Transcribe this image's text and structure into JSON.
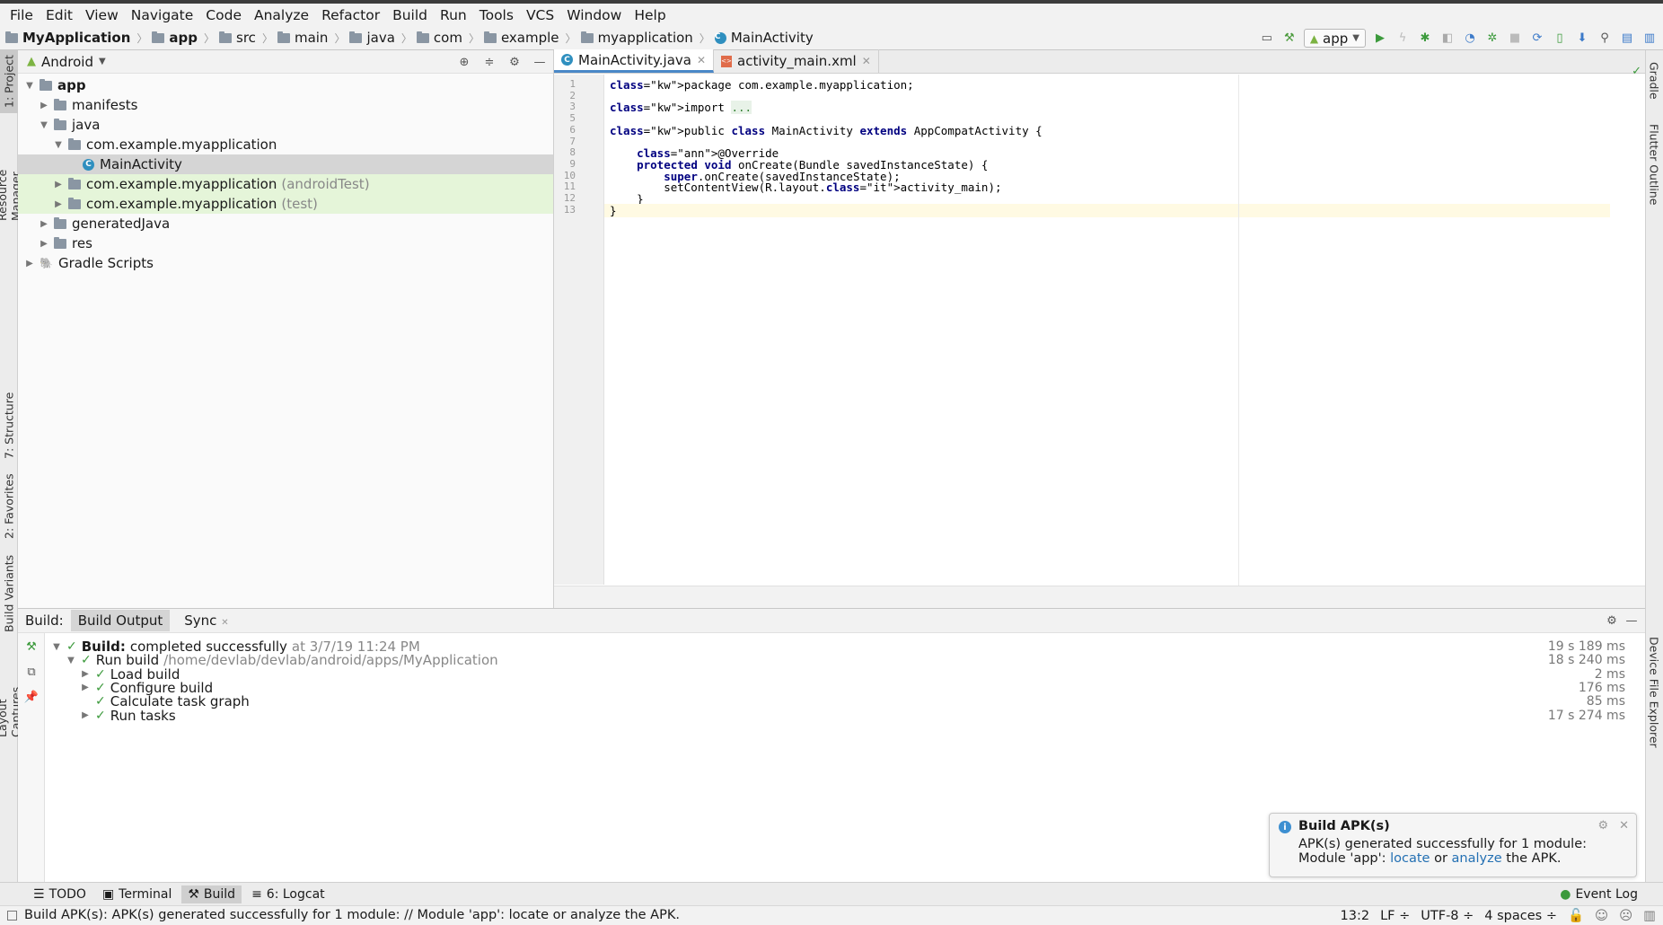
{
  "menu": [
    "File",
    "Edit",
    "View",
    "Navigate",
    "Code",
    "Analyze",
    "Refactor",
    "Build",
    "Run",
    "Tools",
    "VCS",
    "Window",
    "Help"
  ],
  "breadcrumb": [
    "MyApplication",
    "app",
    "src",
    "main",
    "java",
    "com",
    "example",
    "myapplication",
    "MainActivity"
  ],
  "run_config": "app",
  "project": {
    "view": "Android",
    "tree": [
      {
        "label": "app",
        "suffix": "",
        "depth": 0,
        "expanded": true,
        "bold": true
      },
      {
        "label": "manifests",
        "suffix": "",
        "depth": 1,
        "expanded": false
      },
      {
        "label": "java",
        "suffix": "",
        "depth": 1,
        "expanded": true
      },
      {
        "label": "com.example.myapplication",
        "suffix": "",
        "depth": 2,
        "expanded": true
      },
      {
        "label": "MainActivity",
        "suffix": "",
        "depth": 3,
        "leaf": true,
        "selected": true
      },
      {
        "label": "com.example.myapplication",
        "suffix": "(androidTest)",
        "depth": 2,
        "expanded": false,
        "test": true
      },
      {
        "label": "com.example.myapplication",
        "suffix": "(test)",
        "depth": 2,
        "expanded": false,
        "test": true
      },
      {
        "label": "generatedJava",
        "suffix": "",
        "depth": 1,
        "expanded": false
      },
      {
        "label": "res",
        "suffix": "",
        "depth": 1,
        "expanded": false
      },
      {
        "label": "Gradle Scripts",
        "suffix": "",
        "depth": 0,
        "expanded": false
      }
    ]
  },
  "left_tabs": [
    "1: Project",
    "Resource Manager",
    "7: Structure",
    "2: Favorites",
    "Build Variants",
    "Layout Captures"
  ],
  "right_tabs": [
    "Gradle",
    "Flutter Outline",
    "Device File Explorer"
  ],
  "editor": {
    "tabs": [
      {
        "label": "MainActivity.java",
        "active": true
      },
      {
        "label": "activity_main.xml",
        "active": false
      }
    ],
    "line_numbers": [
      "1",
      "2",
      "3",
      "5",
      "6",
      "7",
      "8",
      "9",
      "10",
      "11",
      "12",
      "13"
    ],
    "lines": [
      "package com.example.myapplication;",
      "",
      "import ...",
      "",
      "public class MainActivity extends AppCompatActivity {",
      "",
      "    @Override",
      "    protected void onCreate(Bundle savedInstanceState) {",
      "        super.onCreate(savedInstanceState);",
      "        setContentView(R.layout.activity_main);",
      "    }",
      "}"
    ]
  },
  "build": {
    "label": "Build:",
    "tabs": [
      "Build Output",
      "Sync"
    ],
    "rows": [
      {
        "bold": "Build:",
        "text": "completed successfully",
        "dim": "at 3/7/19 11:24 PM",
        "time": "19 s 189 ms"
      },
      {
        "bold": "",
        "text": "Run build",
        "dim": "/home/devlab/devlab/android/apps/MyApplication",
        "time": "18 s 240 ms"
      },
      {
        "bold": "",
        "text": "Load build",
        "dim": "",
        "time": "2 ms"
      },
      {
        "bold": "",
        "text": "Configure build",
        "dim": "",
        "time": "176 ms"
      },
      {
        "bold": "",
        "text": "Calculate task graph",
        "dim": "",
        "time": "85 ms"
      },
      {
        "bold": "",
        "text": "Run tasks",
        "dim": "",
        "time": "17 s 274 ms"
      }
    ]
  },
  "toast": {
    "title": "Build APK(s)",
    "line1": "APK(s) generated successfully for 1 module:",
    "line2_prefix": "Module 'app':",
    "link_locate": "locate",
    "or": "or",
    "link_analyze": "analyze",
    "line2_suffix": "the APK."
  },
  "toolwindows": [
    "TODO",
    "Terminal",
    "Build",
    "6: Logcat"
  ],
  "event_log": "Event Log",
  "status": {
    "message": "Build APK(s): APK(s) generated successfully for 1 module: // Module 'app': locate or analyze the APK.",
    "position": "13:2",
    "line_sep": "LF ÷",
    "encoding": "UTF-8 ÷",
    "indent": "4 spaces ÷"
  },
  "colors": {
    "accent": "#4a88c7",
    "success": "#3c9a3c",
    "link": "#2470b3",
    "test_bg": "#e5f5d9"
  }
}
